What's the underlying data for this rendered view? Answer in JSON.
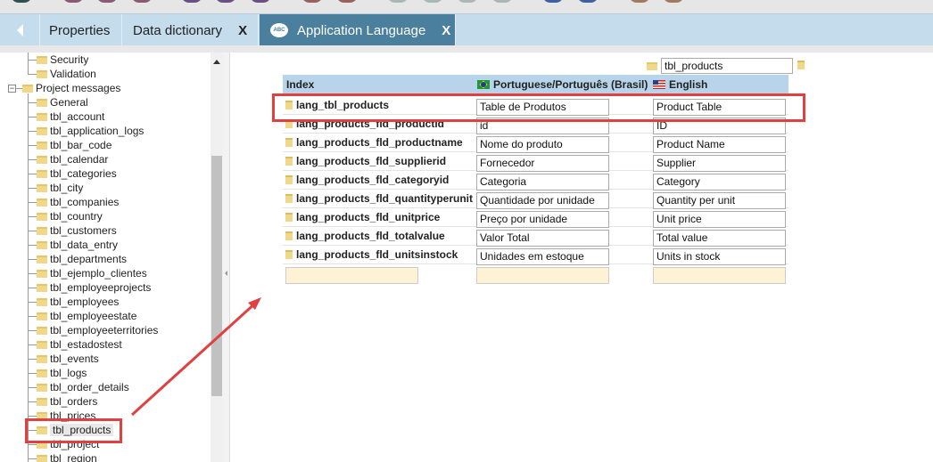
{
  "toolbar": {
    "icon_colors": [
      "#2e5050",
      "#8a5a75",
      "#8a5a75",
      "#8a5a75",
      "#6a4f85",
      "#6a4f85",
      "#6a4f85",
      "#9a6060",
      "#9a6060",
      "#a8b8b2",
      "#a8b8b2",
      "#a8b8b2",
      "#a8b8b2",
      "#3e5fa0",
      "#3e5fa0",
      "#a07a60",
      "#a07a60"
    ]
  },
  "tabs": [
    {
      "label": "Properties",
      "closable": false
    },
    {
      "label": "Data dictionary",
      "close": "X"
    },
    {
      "label": "Application Language",
      "close": "X",
      "icon": "abc-speech-bubble-icon",
      "active": true
    }
  ],
  "tree": {
    "top": [
      "Security",
      "Validation"
    ],
    "group": "Project messages",
    "items": [
      "General",
      "tbl_account",
      "tbl_application_logs",
      "tbl_bar_code",
      "tbl_calendar",
      "tbl_categories",
      "tbl_city",
      "tbl_companies",
      "tbl_country",
      "tbl_customers",
      "tbl_data_entry",
      "tbl_departments",
      "tbl_ejemplo_clientes",
      "tbl_employeeprojects",
      "tbl_employees",
      "tbl_employeestate",
      "tbl_employeeterritories",
      "tbl_estadostest",
      "tbl_events",
      "tbl_logs",
      "tbl_order_details",
      "tbl_orders",
      "tbl_prices",
      "tbl_products",
      "tbl_project",
      "tbl_region"
    ],
    "selected": "tbl_products"
  },
  "main": {
    "table_name": "tbl_products",
    "headers": {
      "index": "Index",
      "pt": "Portuguese/Português (Brasil)",
      "en": "English"
    },
    "rows": [
      {
        "index": "lang_tbl_products",
        "pt": "Table de Produtos",
        "en": "Product Table"
      },
      {
        "index": "lang_products_fld_productid",
        "pt": "id",
        "en": "ID"
      },
      {
        "index": "lang_products_fld_productname",
        "pt": "Nome do produto",
        "en": "Product Name"
      },
      {
        "index": "lang_products_fld_supplierid",
        "pt": "Fornecedor",
        "en": "Supplier"
      },
      {
        "index": "lang_products_fld_categoryid",
        "pt": "Categoria",
        "en": "Category"
      },
      {
        "index": "lang_products_fld_quantityperunit",
        "pt": "Quantidade por unidade",
        "en": "Quantity per unit"
      },
      {
        "index": "lang_products_fld_unitprice",
        "pt": "Preço por unidade",
        "en": "Unit price"
      },
      {
        "index": "lang_products_fld_totalvalue",
        "pt": "Valor Total",
        "en": "Total value"
      },
      {
        "index": "lang_products_fld_unitsinstock",
        "pt": "Unidades em estoque",
        "en": "Units in stock"
      }
    ],
    "new_row": {
      "index": "",
      "pt": "",
      "en": ""
    }
  },
  "annotation_color": "#e04040"
}
